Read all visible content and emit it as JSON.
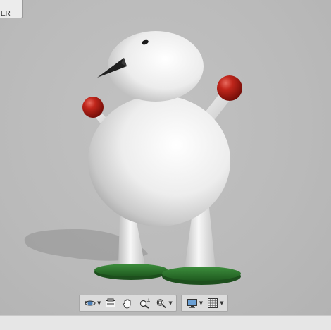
{
  "viewcube": {
    "face_label": "ER"
  },
  "navigation_bar": {
    "groups": [
      {
        "tools": [
          {
            "icon": "orbit-icon",
            "has_menu": true
          },
          {
            "icon": "look-at-icon",
            "has_menu": false
          },
          {
            "icon": "pan-hand-icon",
            "has_menu": false
          },
          {
            "icon": "zoom-icon",
            "has_menu": false
          },
          {
            "icon": "zoom-window-icon",
            "has_menu": true
          }
        ]
      },
      {
        "tools": [
          {
            "icon": "display-settings-icon",
            "has_menu": true
          },
          {
            "icon": "grid-icon",
            "has_menu": true
          }
        ]
      }
    ]
  },
  "colors": {
    "background": "#bababa",
    "body_white": "#f2f2f2",
    "nose": "#222222",
    "hands_red": "#a51a12",
    "base_green": "#2f7a2f"
  }
}
